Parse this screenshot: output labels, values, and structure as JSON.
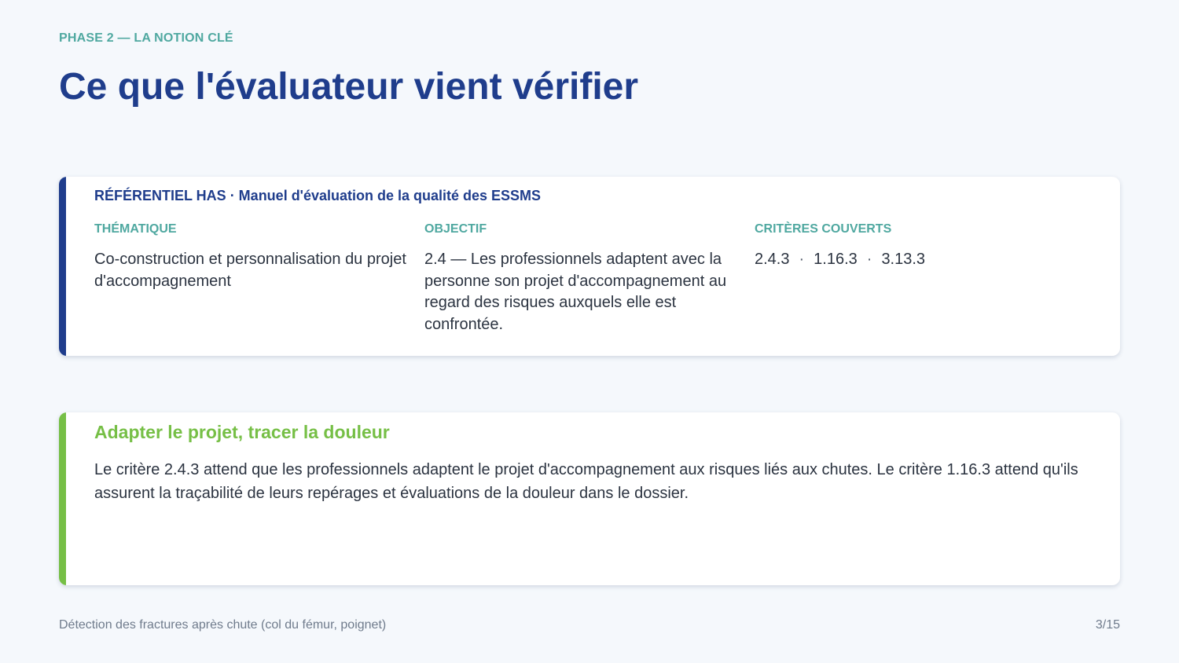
{
  "header": {
    "eyebrow": "PHASE 2 — LA NOTION CLÉ",
    "title": "Ce que l'évaluateur vient vérifier"
  },
  "referentiel": {
    "heading": "RÉFÉRENTIEL HAS · Manuel d'évaluation de la qualité des ESSMS",
    "accent_color": "#1f3d8c",
    "columns": [
      {
        "label": "THÉMATIQUE",
        "value": "Co-construction et personnalisation du projet d'accompagnement"
      },
      {
        "label": "OBJECTIF",
        "value": "2.4 — Les professionnels adaptent avec la personne son projet d'accompagnement au regard des risques auxquels elle est confrontée."
      },
      {
        "label": "CRITÈRES COUVERTS",
        "criteria": [
          "2.4.3",
          "1.16.3",
          "3.13.3"
        ],
        "separator": "·"
      }
    ]
  },
  "adapt": {
    "title": "Adapter le projet, tracer la douleur",
    "text": "Le critère 2.4.3 attend que les professionnels adaptent le projet d'accompagnement aux risques liés aux chutes. Le critère 1.16.3 attend qu'ils assurent la traçabilité de leurs repérages et évaluations de la douleur dans le dossier.",
    "accent_color": "#76bf46"
  },
  "footer": {
    "left": "Détection des fractures après chute (col du fémur, poignet)",
    "page": "3/15"
  },
  "colors": {
    "background": "#f5f8fc",
    "primary": "#1f3d8c",
    "teal": "#4fa8a0",
    "green": "#76bf46"
  }
}
